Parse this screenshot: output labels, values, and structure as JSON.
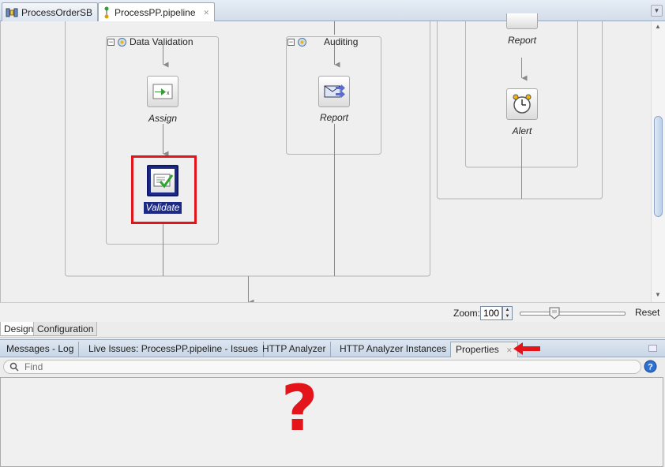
{
  "editor_tabs": [
    {
      "label": "ProcessOrderSB",
      "active": false
    },
    {
      "label": "ProcessPP.pipeline",
      "active": true
    }
  ],
  "pipeline": {
    "stages": [
      {
        "title": "Data Validation",
        "actions": [
          "Assign",
          "Validate"
        ]
      },
      {
        "title": "Auditing",
        "actions": [
          "Report"
        ]
      },
      {
        "title": "",
        "actions": [
          "Report",
          "Alert"
        ]
      }
    ],
    "selected_action": "Validate"
  },
  "zoom": {
    "label": "Zoom:",
    "value": "100",
    "reset_label": "Reset"
  },
  "view_tabs": [
    {
      "label": "Design",
      "active": true
    },
    {
      "label": "Configuration",
      "active": false
    }
  ],
  "panel_tabs": [
    {
      "label": "Messages - Log",
      "active": false
    },
    {
      "label": "Live Issues: ProcessPP.pipeline - Issues",
      "active": false
    },
    {
      "label": "HTTP Analyzer",
      "active": false
    },
    {
      "label": "HTTP Analyzer Instances",
      "active": false
    },
    {
      "label": "Properties",
      "active": true
    }
  ],
  "find": {
    "placeholder": "Find"
  },
  "annotation": {
    "mark": "?"
  },
  "colors": {
    "highlight": "#e3151b",
    "selection": "#1c2a86"
  }
}
